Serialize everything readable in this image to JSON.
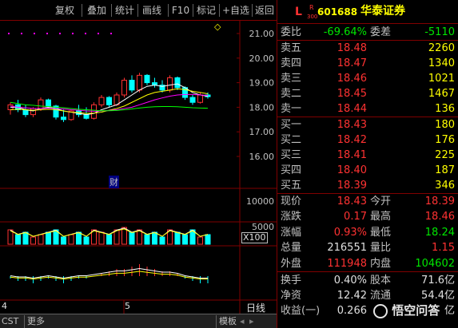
{
  "toolbar": {
    "items": [
      "复权",
      "叠加",
      "统计",
      "画线",
      "F10",
      "标记",
      "+自选",
      "返回"
    ]
  },
  "chart": {
    "price_labels": [
      "21.00",
      "20.00",
      "19.00",
      "18.00",
      "17.00",
      "16.00"
    ],
    "volume_labels": [
      "10000",
      "5000"
    ],
    "volume_unit": "X100",
    "news_marker": "财",
    "diamond": "◇",
    "month_labels": [
      "4",
      "5"
    ],
    "period": "日线",
    "colors": {
      "up": "#ff3232",
      "down": "#00ffff",
      "ma1": "#ffffff",
      "ma2": "#ffff00",
      "ma3": "#ff00ff",
      "ma4": "#00ff00"
    },
    "candles": [
      {
        "o": 17.9,
        "h": 18.2,
        "l": 17.7,
        "c": 18.1
      },
      {
        "o": 18.1,
        "h": 18.3,
        "l": 17.8,
        "c": 17.9
      },
      {
        "o": 17.9,
        "h": 18.1,
        "l": 17.6,
        "c": 17.7
      },
      {
        "o": 17.7,
        "h": 18.0,
        "l": 17.6,
        "c": 17.95
      },
      {
        "o": 17.95,
        "h": 18.4,
        "l": 17.85,
        "c": 18.3
      },
      {
        "o": 18.3,
        "h": 18.35,
        "l": 18.0,
        "c": 18.05
      },
      {
        "o": 18.05,
        "h": 18.1,
        "l": 17.5,
        "c": 17.6
      },
      {
        "o": 17.6,
        "h": 17.9,
        "l": 17.4,
        "c": 17.5
      },
      {
        "o": 17.5,
        "h": 17.9,
        "l": 17.45,
        "c": 17.85
      },
      {
        "o": 17.85,
        "h": 18.1,
        "l": 17.6,
        "c": 17.7
      },
      {
        "o": 17.7,
        "h": 18.0,
        "l": 17.5,
        "c": 17.55
      },
      {
        "o": 17.55,
        "h": 18.2,
        "l": 17.5,
        "c": 18.1
      },
      {
        "o": 18.1,
        "h": 18.5,
        "l": 18.0,
        "c": 18.4
      },
      {
        "o": 18.4,
        "h": 18.45,
        "l": 18.0,
        "c": 18.1
      },
      {
        "o": 18.1,
        "h": 18.6,
        "l": 18.05,
        "c": 18.5
      },
      {
        "o": 18.5,
        "h": 19.2,
        "l": 18.4,
        "c": 19.1
      },
      {
        "o": 19.1,
        "h": 19.3,
        "l": 18.6,
        "c": 18.7
      },
      {
        "o": 18.7,
        "h": 19.4,
        "l": 18.6,
        "c": 19.3
      },
      {
        "o": 19.3,
        "h": 19.35,
        "l": 18.9,
        "c": 19.0
      },
      {
        "o": 19.0,
        "h": 19.2,
        "l": 18.8,
        "c": 18.9
      },
      {
        "o": 18.9,
        "h": 19.1,
        "l": 18.6,
        "c": 18.7
      },
      {
        "o": 18.7,
        "h": 19.3,
        "l": 18.6,
        "c": 19.2
      },
      {
        "o": 19.2,
        "h": 19.25,
        "l": 18.7,
        "c": 18.8
      },
      {
        "o": 18.8,
        "h": 18.85,
        "l": 18.3,
        "c": 18.4
      },
      {
        "o": 18.4,
        "h": 18.5,
        "l": 18.1,
        "c": 18.2
      },
      {
        "o": 18.2,
        "h": 18.6,
        "l": 18.15,
        "c": 18.5
      },
      {
        "o": 18.5,
        "h": 18.6,
        "l": 18.35,
        "c": 18.43
      }
    ],
    "volumes": [
      6,
      4,
      5,
      3,
      4,
      5,
      6,
      3,
      4,
      5,
      3,
      6,
      5,
      4,
      6,
      7,
      5,
      6,
      4,
      5,
      3,
      6,
      5,
      4,
      6,
      3,
      4
    ],
    "ma": {
      "ma1": [
        18.0,
        18.0,
        17.9,
        17.85,
        17.95,
        18.0,
        17.95,
        17.85,
        17.8,
        17.75,
        17.7,
        17.75,
        17.9,
        18.0,
        18.1,
        18.3,
        18.5,
        18.7,
        18.85,
        18.9,
        18.85,
        18.9,
        18.95,
        18.8,
        18.6,
        18.5,
        18.45
      ],
      "ma2": [
        17.9,
        17.92,
        17.9,
        17.88,
        17.9,
        17.92,
        17.9,
        17.85,
        17.8,
        17.78,
        17.75,
        17.76,
        17.8,
        17.88,
        17.95,
        18.05,
        18.2,
        18.35,
        18.5,
        18.6,
        18.65,
        18.7,
        18.75,
        18.72,
        18.65,
        18.6,
        18.55
      ],
      "ma3": [
        18.05,
        18.0,
        17.98,
        17.95,
        17.95,
        17.96,
        17.95,
        17.93,
        17.9,
        17.88,
        17.85,
        17.84,
        17.85,
        17.87,
        17.9,
        17.95,
        18.0,
        18.1,
        18.2,
        18.3,
        18.38,
        18.45,
        18.5,
        18.52,
        18.52,
        18.5,
        18.48
      ],
      "ma4": [
        18.2,
        18.15,
        18.1,
        18.08,
        18.05,
        18.03,
        18.0,
        17.98,
        17.95,
        17.92,
        17.9,
        17.88,
        17.86,
        17.86,
        17.87,
        17.9,
        17.93,
        17.97,
        18.0,
        18.02,
        18.03,
        18.03,
        18.02,
        18.0,
        17.98,
        17.97,
        17.96
      ]
    },
    "macd": [
      -1,
      -2,
      -2,
      -3,
      -2,
      -1,
      -2,
      -3,
      -2,
      -1,
      -1,
      0,
      1,
      2,
      3,
      3,
      4,
      5,
      4,
      3,
      2,
      2,
      1,
      -1,
      -2,
      -3,
      -3
    ]
  },
  "quote": {
    "logo": "L",
    "logo_sup": "R",
    "logo_sub": "300",
    "code": "601688",
    "name": "华泰证券",
    "weibi_label": "委比",
    "weibi": "-69.64%",
    "weicha_label": "委差",
    "weicha": "-5110",
    "sells": [
      {
        "label": "卖五",
        "price": "18.48",
        "vol": "2260"
      },
      {
        "label": "卖四",
        "price": "18.47",
        "vol": "1340"
      },
      {
        "label": "卖三",
        "price": "18.46",
        "vol": "1021"
      },
      {
        "label": "卖二",
        "price": "18.45",
        "vol": "1467"
      },
      {
        "label": "卖一",
        "price": "18.44",
        "vol": "136"
      }
    ],
    "buys": [
      {
        "label": "买一",
        "price": "18.43",
        "vol": "180"
      },
      {
        "label": "买二",
        "price": "18.42",
        "vol": "176"
      },
      {
        "label": "买三",
        "price": "18.41",
        "vol": "225"
      },
      {
        "label": "买四",
        "price": "18.40",
        "vol": "187"
      },
      {
        "label": "买五",
        "price": "18.39",
        "vol": "346"
      }
    ],
    "stats": [
      {
        "l1": "现价",
        "v1": "18.43",
        "c1": "red",
        "l2": "今开",
        "v2": "18.39",
        "c2": "red"
      },
      {
        "l1": "涨跌",
        "v1": "0.17",
        "c1": "red",
        "l2": "最高",
        "v2": "18.46",
        "c2": "red"
      },
      {
        "l1": "涨幅",
        "v1": "0.93%",
        "c1": "red",
        "l2": "最低",
        "v2": "18.24",
        "c2": "grn"
      },
      {
        "l1": "总量",
        "v1": "216551",
        "c1": "wht",
        "l2": "量比",
        "v2": "1.15",
        "c2": "red"
      },
      {
        "l1": "外盘",
        "v1": "111948",
        "c1": "red",
        "l2": "内盘",
        "v2": "104602",
        "c2": "grn"
      }
    ],
    "extra": [
      {
        "l1": "换手",
        "v1": "0.40%",
        "l2": "股本",
        "v2": "71.6亿"
      },
      {
        "l1": "净资",
        "v1": "12.42",
        "l2": "流通",
        "v2": "54.4亿"
      },
      {
        "l1": "收益(一)",
        "v1": "0.266",
        "l2": "",
        "v2": "亿"
      }
    ],
    "watermark": "悟空问答"
  },
  "bottom": {
    "tab1": "CST",
    "tab2": "更多",
    "tab3": "模板"
  }
}
